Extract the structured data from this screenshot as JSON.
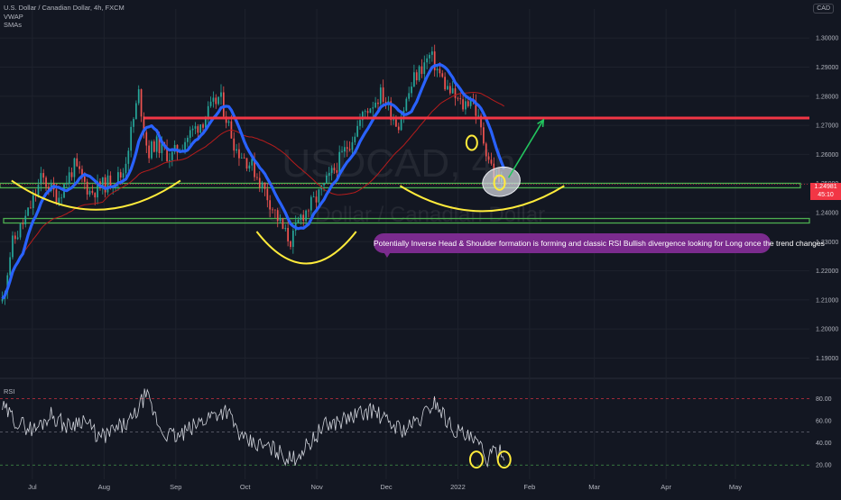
{
  "header": {
    "symbol_title": "U.S. Dollar / Canadian Dollar, 4h, FXCM",
    "indicator_1": "VWAP",
    "indicator_2": "SMAs",
    "currency": "CAD"
  },
  "watermark": {
    "ticker": "USDCAD, 4h",
    "name": "U.S. Dollar / Canadian Dollar"
  },
  "annotation": {
    "text": "Potentially Inverse Head & Shoulder formation is forming and classic RSI Bullish divergence looking for Long once the trend changes"
  },
  "last_price": {
    "price": "1.24981",
    "countdown": "45:10"
  },
  "rsi_panel": {
    "title": "RSI"
  },
  "colors": {
    "background": "#131722",
    "bull_candle": "#26a69a",
    "bear_candle": "#ef5350",
    "sma_fast": "#2962ff",
    "sma_slow": "#b71c1c",
    "resistance_line": "#f23645",
    "support_band": "#4caf50",
    "drawing_yellow": "#ffeb3b",
    "arrow_green": "#22c55e",
    "rsi_line": "#d1d4dc",
    "annotation_bg": "#7b2b8e"
  },
  "chart_data": [
    {
      "type": "candlestick",
      "title": "U.S. Dollar / Canadian Dollar, 4h, FXCM",
      "y_ticks": [
        "1.30000",
        "1.29000",
        "1.28000",
        "1.27000",
        "1.26000",
        "1.25000",
        "1.24000",
        "1.23000",
        "1.22000",
        "1.21000",
        "1.20000",
        "1.19000"
      ],
      "ylim": [
        1.1855,
        1.3075
      ],
      "x_ticks": [
        "Jul",
        "Aug",
        "Sep",
        "Oct",
        "Nov",
        "Dec",
        "2022",
        "Feb",
        "Mar",
        "Apr",
        "May"
      ],
      "close_path": {
        "x": [
          "2021-06-18",
          "2021-06-22",
          "2021-06-29",
          "2021-07-05",
          "2021-07-12",
          "2021-07-19",
          "2021-07-26",
          "2021-08-02",
          "2021-08-09",
          "2021-08-16",
          "2021-08-20",
          "2021-08-23",
          "2021-08-30",
          "2021-09-06",
          "2021-09-13",
          "2021-09-20",
          "2021-09-27",
          "2021-10-04",
          "2021-10-11",
          "2021-10-18",
          "2021-10-21",
          "2021-10-25",
          "2021-11-01",
          "2021-11-08",
          "2021-11-15",
          "2021-11-22",
          "2021-11-29",
          "2021-12-06",
          "2021-12-13",
          "2021-12-20",
          "2021-12-27",
          "2022-01-03",
          "2022-01-07",
          "2022-01-12",
          "2022-01-17",
          "2022-01-21"
        ],
        "y": [
          1.2095,
          1.2288,
          1.2395,
          1.252,
          1.2452,
          1.256,
          1.247,
          1.25,
          1.253,
          1.281,
          1.26,
          1.264,
          1.259,
          1.266,
          1.272,
          1.28,
          1.262,
          1.256,
          1.245,
          1.233,
          1.23,
          1.2385,
          1.245,
          1.254,
          1.264,
          1.275,
          1.281,
          1.27,
          1.286,
          1.294,
          1.283,
          1.2765,
          1.28,
          1.265,
          1.252,
          1.2498
        ]
      },
      "levels": {
        "resistance": 1.2725,
        "neckline_support": 1.2493,
        "lower_support": 1.2372,
        "last_price": 1.24981
      },
      "patterns": [
        "left shoulder",
        "head",
        "right shoulder"
      ],
      "projection": {
        "from": 1.252,
        "to": 1.2725
      }
    },
    {
      "type": "line",
      "title": "RSI",
      "y_ticks": [
        "80.00",
        "60.00",
        "40.00",
        "20.00"
      ],
      "ylim": [
        12,
        92
      ],
      "guide_levels": [
        80,
        50,
        20
      ],
      "series": [
        {
          "x": [
            "2021-06-18",
            "2021-06-25",
            "2021-07-02",
            "2021-07-09",
            "2021-07-16",
            "2021-07-23",
            "2021-07-30",
            "2021-08-06",
            "2021-08-13",
            "2021-08-19",
            "2021-08-26",
            "2021-09-02",
            "2021-09-09",
            "2021-09-16",
            "2021-09-23",
            "2021-09-30",
            "2021-10-07",
            "2021-10-14",
            "2021-10-21",
            "2021-10-28",
            "2021-11-04",
            "2021-11-11",
            "2021-11-18",
            "2021-11-25",
            "2021-12-02",
            "2021-12-09",
            "2021-12-16",
            "2021-12-22",
            "2021-12-29",
            "2022-01-05",
            "2022-01-10",
            "2022-01-14",
            "2022-01-19",
            "2022-01-21"
          ],
          "values": [
            72,
            58,
            52,
            66,
            55,
            62,
            44,
            52,
            60,
            84,
            50,
            45,
            55,
            65,
            70,
            42,
            38,
            34,
            24,
            38,
            55,
            60,
            65,
            70,
            58,
            52,
            62,
            78,
            55,
            45,
            38,
            25,
            35,
            32
          ]
        }
      ]
    }
  ]
}
